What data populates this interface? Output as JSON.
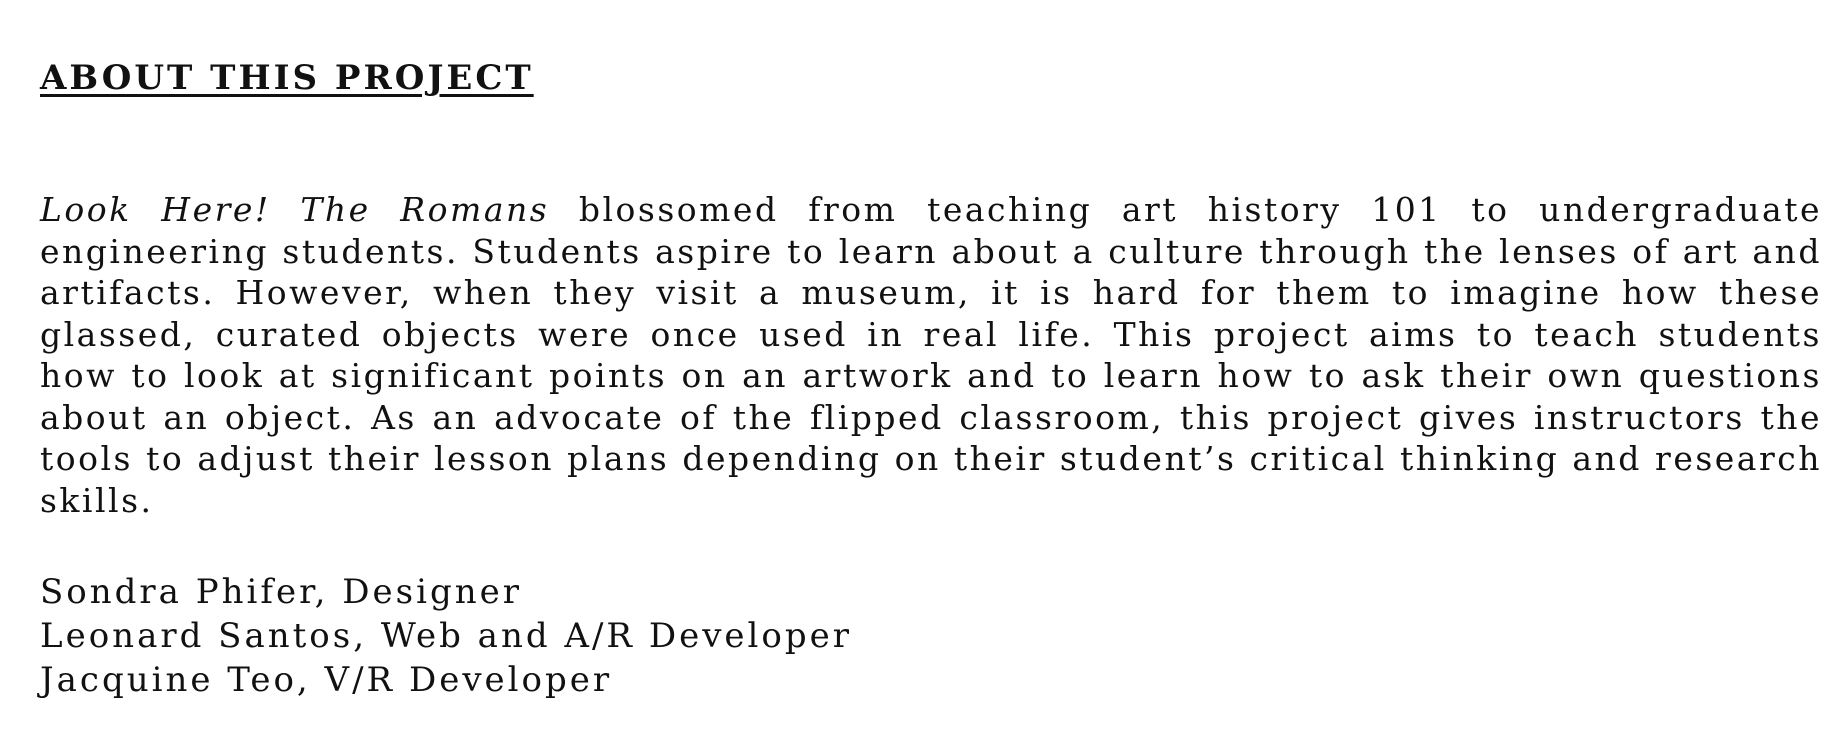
{
  "heading": "ABOUT THIS PROJECT",
  "about": {
    "title_italic": "Look Here! The Romans",
    "body": " blossomed from teaching art history 101 to undergraduate engineering students. Students aspire to learn about a culture through the lenses of art and artifacts. However, when they visit a museum, it is hard for them to imagine how these glassed, curated objects were once used in real life. This project aims to teach students how to look at significant points on an artwork and to learn how to ask their own questions about an object. As an advocate of the flipped classroom, this project gives instructors the tools to adjust their lesson plans depending on their student’s critical thinking and research skills."
  },
  "credits": [
    "Sondra Phifer, Designer",
    "Leonard Santos, Web and A/R Developer",
    "Jacquine Teo, V/R Developer"
  ]
}
